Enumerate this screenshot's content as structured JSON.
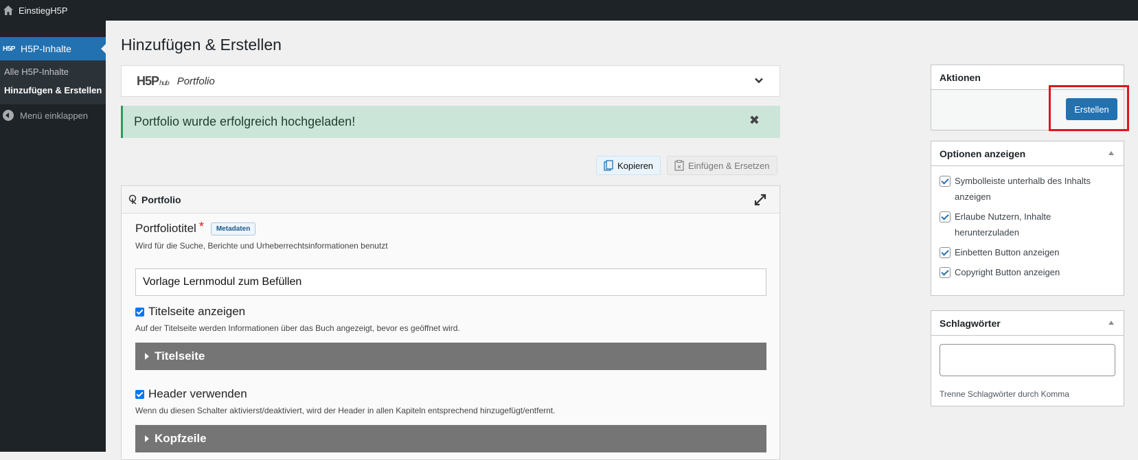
{
  "adminbar": {
    "site_name": "EinstiegH5P"
  },
  "sidebar": {
    "menu_top_icon_text": "H5P",
    "menu_top_label": "H5P-Inhalte",
    "items": [
      {
        "label": "Alle H5P-Inhalte"
      },
      {
        "label": "Hinzufügen & Erstellen"
      }
    ],
    "collapse_label": "Menü einklappen"
  },
  "page": {
    "title": "Hinzufügen & Erstellen"
  },
  "hub": {
    "logo_text": "H5P",
    "logo_sub": "hub",
    "content_type": "Portfolio"
  },
  "notice": {
    "message": "Portfolio wurde erfolgreich hochgeladen!",
    "close": "✖"
  },
  "clipboard": {
    "copy_label": "Kopieren",
    "paste_label": "Einfügen & Ersetzen"
  },
  "editor": {
    "header": "Portfolio",
    "title_label": "Portfoliotitel",
    "required_mark": "*",
    "metadata_label": "Metadaten",
    "title_desc": "Wird für die Suche, Berichte und Urheberrechtsinformationen benutzt",
    "title_value": "Vorlage Lernmodul zum Befüllen",
    "show_cover_label": "Titelseite anzeigen",
    "show_cover_desc": "Auf der Titelseite werden Informationen über das Buch angezeigt, bevor es geöffnet wird.",
    "cover_group": "Titelseite",
    "use_header_label": "Header verwenden",
    "use_header_desc": "Wenn du diesen Schalter aktivierst/deaktiviert, wird der Header in allen Kapiteln entsprechend hinzugefügt/entfernt.",
    "header_group": "Kopfzeile"
  },
  "actions": {
    "title": "Aktionen",
    "create_label": "Erstellen"
  },
  "display_options": {
    "title": "Optionen anzeigen",
    "items": [
      {
        "label": "Symbolleiste unterhalb des Inhalts anzeigen",
        "checked": true
      },
      {
        "label": "Erlaube Nutzern, Inhalte herunterzuladen",
        "checked": true
      },
      {
        "label": "Einbetten Button anzeigen",
        "checked": true
      },
      {
        "label": "Copyright Button anzeigen",
        "checked": true
      }
    ]
  },
  "tags": {
    "title": "Schlagwörter",
    "hint": "Trenne Schlagwörter durch Komma"
  },
  "colors": {
    "accent": "#2271b1",
    "highlight": "#e0141d",
    "notice_bg": "#cce5d9",
    "group_bg": "#767576"
  }
}
